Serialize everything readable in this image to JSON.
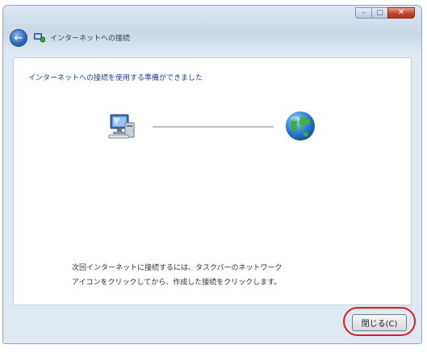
{
  "window": {
    "title": "インターネットへの接続",
    "caption_buttons": {
      "minimize": "–",
      "maximize": "□",
      "close": "✕"
    }
  },
  "content": {
    "heading": "インターネットへの接続を使用する準備ができました",
    "instructions": [
      "次回インターネットに接続するには、タスクバーのネットワーク",
      "アイコンをクリックしてから、作成した接続をクリックします。"
    ]
  },
  "footer": {
    "next_label": "閉じる(C)"
  },
  "colors": {
    "accent": "#1c3f8c",
    "highlight": "#d81e1e",
    "close_button": "#c4412c"
  },
  "icons": [
    "back-arrow-icon",
    "wizard-icon",
    "computer-icon",
    "globe-icon"
  ]
}
